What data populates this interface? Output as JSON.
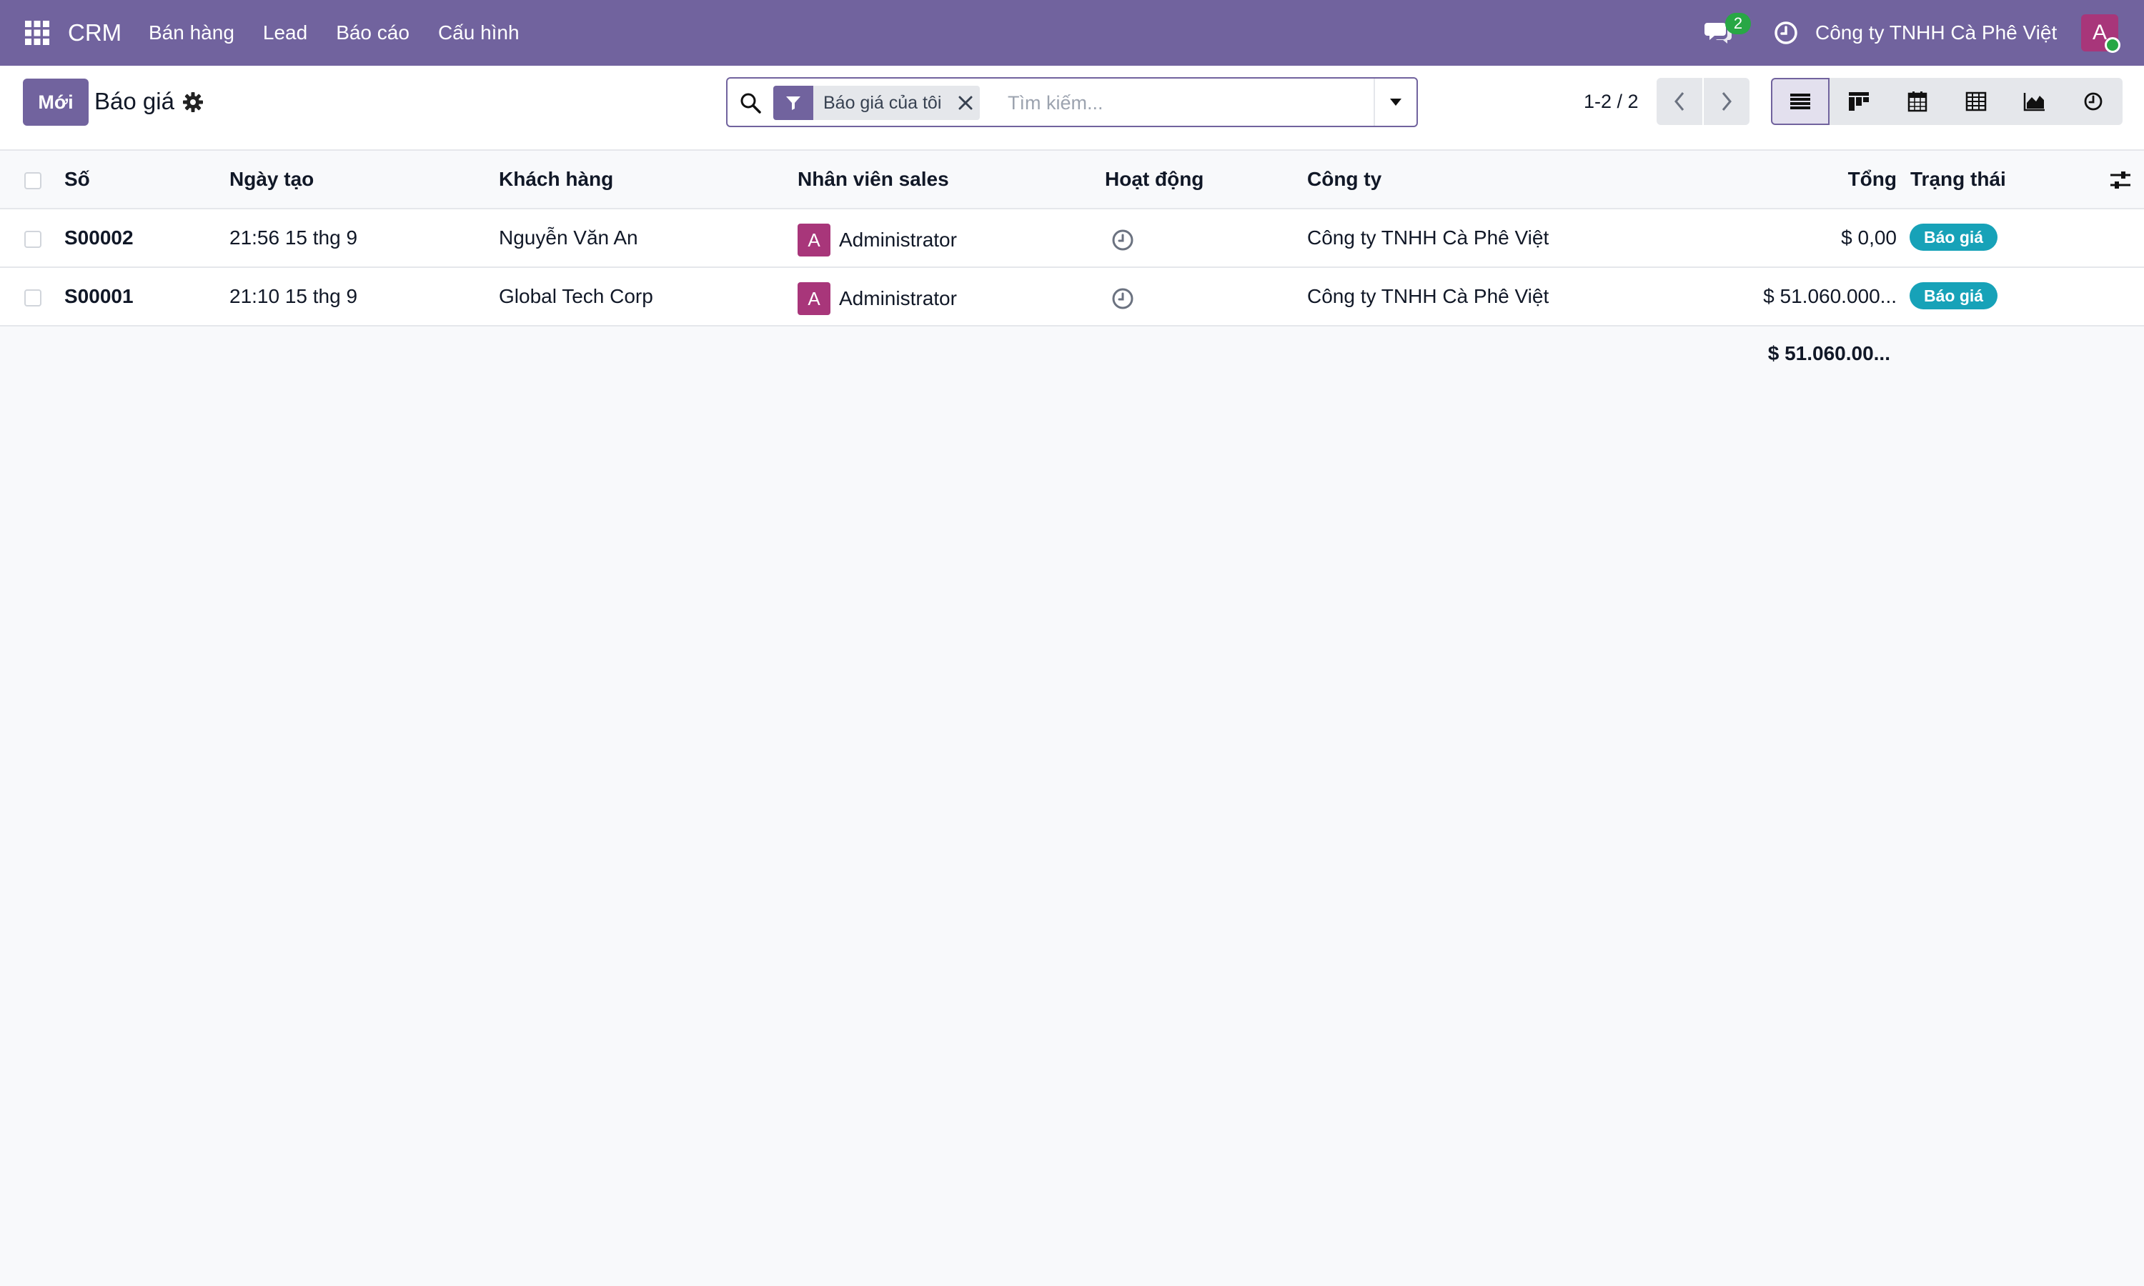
{
  "navbar": {
    "brand": "CRM",
    "menu": [
      "Bán hàng",
      "Lead",
      "Báo cáo",
      "Cấu hình"
    ],
    "chat_badge": "2",
    "company": "Công ty TNHH Cà Phê Việt",
    "avatar_letter": "A",
    "accent": "#71639e"
  },
  "control": {
    "new_label": "Mới",
    "title": "Báo giá",
    "facet_label": "Báo giá của tôi",
    "search_placeholder": "Tìm kiếm...",
    "pager": "1-2 / 2",
    "views": [
      "list-icon",
      "kanban-icon",
      "calendar-icon",
      "pivot-icon",
      "graph-icon",
      "activity-icon"
    ]
  },
  "table": {
    "columns": [
      "Số",
      "Ngày tạo",
      "Khách hàng",
      "Nhân viên sales",
      "Hoạt động",
      "Công ty",
      "Tổng",
      "Trạng thái"
    ],
    "rows": [
      {
        "number": "S00002",
        "date": "21:56 15 thg 9",
        "customer": "Nguyễn Văn An",
        "salesperson_avatar": "A",
        "salesperson": "Administrator",
        "company": "Công ty TNHH Cà Phê Việt",
        "total": "$ 0,00",
        "state": "Báo giá"
      },
      {
        "number": "S00001",
        "date": "21:10 15 thg 9",
        "customer": "Global Tech Corp",
        "salesperson_avatar": "A",
        "salesperson": "Administrator",
        "company": "Công ty TNHH Cà Phê Việt",
        "total": "$ 51.060.000...",
        "state": "Báo giá"
      }
    ],
    "footer_total": "$ 51.060.00...",
    "state_color": "#17a2b8"
  }
}
